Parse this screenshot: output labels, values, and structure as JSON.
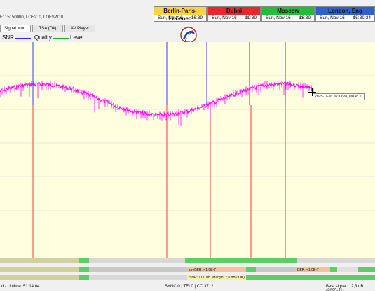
{
  "header": {
    "tuner_info": "F1: 5150000, LOF2: 0, LOFSW: 0",
    "clocks": [
      {
        "city": "Berlin-Paris-Lučenec",
        "date": "Sun, Nov 16",
        "time": "16:39",
        "offset": "",
        "color": "#ffd23f"
      },
      {
        "city": "Dubai",
        "date": "Sun, Nov 16",
        "time": "19:39",
        "offset": "+3",
        "color": "#e8272a"
      },
      {
        "city": "Moscow",
        "date": "Sun, Nov 16",
        "time": "18:39",
        "offset": "+2",
        "color": "#1fbf3a"
      },
      {
        "city": "London, Eng",
        "date": "Sun, Nov 16",
        "time": "15:39:34",
        "offset": "-1",
        "color": "#2f5fd0"
      }
    ]
  },
  "tabs": [
    {
      "label": "Signal Mon."
    },
    {
      "label": "TSA (Ok)"
    },
    {
      "label": "AV Player"
    }
  ],
  "legend": {
    "snr": {
      "label": "SNR",
      "color": "#ff00ff"
    },
    "quality": {
      "label": "Quality",
      "color": "#2a2aff"
    },
    "level": {
      "label": "Level",
      "color": "#22b022"
    }
  },
  "logo": {
    "site": "www.dxsatcs.com"
  },
  "tooltip": {
    "text": "2025-11-16 16:33:28, value: 11"
  },
  "strips": {
    "preber": "preBER: <1.0E-7",
    "ber": "BER: <1.0E-7",
    "snr": "SNR: 11,0 dB (Margin: 7,0 dB / OK)"
  },
  "statusbar": {
    "uptime": "d - Uptime: 51:14:04",
    "sync": "SYNC 0 | TEI 0 | CC 3712",
    "best": "Best signal: 12,3 dB (2025-11-..."
  },
  "chart_data": {
    "type": "line",
    "series": [
      {
        "name": "SNR",
        "color": "#ff00ff"
      },
      {
        "name": "Quality",
        "color": "#2a2aff"
      },
      {
        "name": "Level",
        "color": "#22b022"
      }
    ]
  }
}
